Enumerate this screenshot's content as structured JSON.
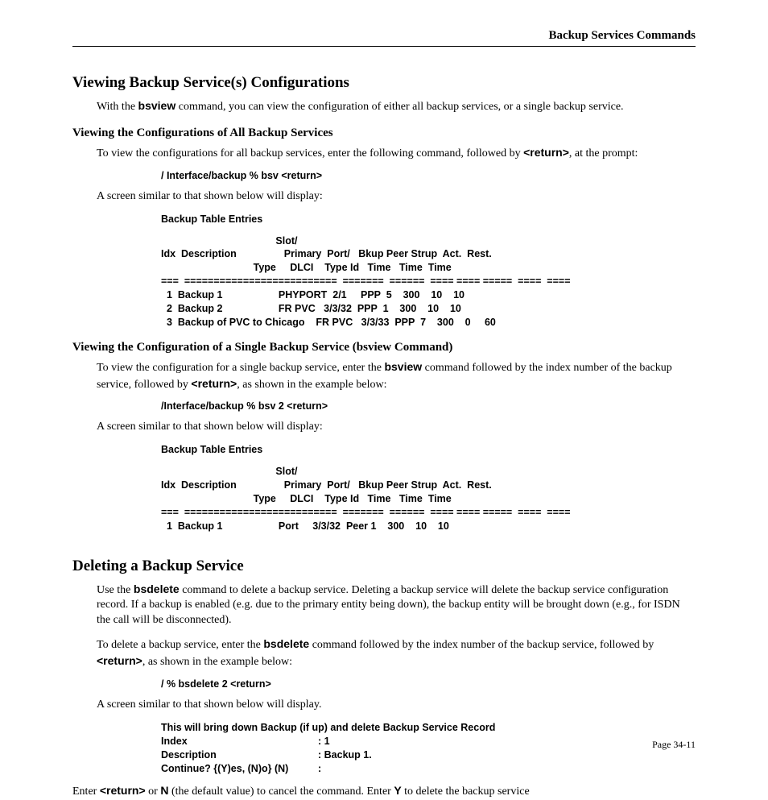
{
  "header": {
    "running": "Backup Services Commands"
  },
  "sec1": {
    "title": "Viewing Backup Service(s) Configurations",
    "intro_a": "With the ",
    "intro_cmd": "bsview",
    "intro_b": " command, you can view the configuration of either all backup services, or a single backup service.",
    "sub1": {
      "title": "Viewing the Configurations of All Backup Services",
      "p1_a": "To view the configurations for all backup services, enter the following command, followed by ",
      "p1_ret": "<return>",
      "p1_b": ", at the prompt:",
      "cmd": "/ Interface/backup % bsv <return>",
      "p2": "A screen similar to that shown below will display:",
      "table_title": "Backup Table Entries",
      "table_header": "                                         Slot/\nIdx  Description                 Primary  Port/   Bkup Peer Strup  Act.  Rest.\n                                 Type     DLCI    Type Id   Time   Time  Time\n===  ==========================  =======  ======  ==== ==== =====  ====  ====",
      "rows": "  1  Backup 1                    PHYPORT  2/1     PPP  5    300    10    10\n  2  Backup 2                    FR PVC   3/3/32  PPP  1    300    10    10\n  3  Backup of PVC to Chicago    FR PVC   3/3/33  PPP  7    300    0     60"
    },
    "sub2": {
      "title": "Viewing the Configuration of a Single Backup Service (bsview Command)",
      "p1_a": "To view the configuration for a single backup service, enter the ",
      "p1_cmd": "bsview",
      "p1_b": " command followed by the index number of the backup service, followed by ",
      "p1_ret": "<return>",
      "p1_c": ", as shown in the example below:",
      "cmd": "/Interface/backup % bsv 2 <return>",
      "p2": "A screen similar to that shown below will display:",
      "table_title": "Backup Table Entries",
      "table_header": "                                         Slot/\nIdx  Description                 Primary  Port/   Bkup Peer Strup  Act.  Rest.\n                                 Type     DLCI    Type Id   Time   Time  Time\n===  ==========================  =======  ======  ==== ==== =====  ====  ====",
      "rows": "  1  Backup 1                    Port     3/3/32  Peer 1    300    10    10"
    }
  },
  "sec2": {
    "title": "Deleting a Backup Service",
    "p1_a": "Use the ",
    "p1_cmd": "bsdelete",
    "p1_b": " command to delete a backup service. Deleting a backup service will delete the backup service configuration record. If a backup is enabled (e.g. due to the primary entity being down), the backup entity will be brought down (e.g., for ISDN the call will be disconnected).",
    "p2_a": "To delete a backup service, enter the ",
    "p2_cmd": "bsdelete",
    "p2_b": " command followed by the index number of the backup service, followed by ",
    "p2_ret": "<return>",
    "p2_c": ", as shown in the example below:",
    "cmd": "/ % bsdelete 2 <return>",
    "p3": "A screen similar to that shown below will display.",
    "out_line1": "This will bring down Backup (if up) and delete Backup Service Record",
    "kv": [
      {
        "k": "Index",
        "v": ": 1"
      },
      {
        "k": "Description",
        "v": ": Backup 1."
      },
      {
        "k": "Continue? {(Y)es, (N)o} (N)",
        "v": ":"
      }
    ],
    "p4_a": "Enter ",
    "p4_ret": "<return>",
    "p4_b": " or ",
    "p4_n": "N",
    "p4_c": " (the default value) to cancel the command. Enter ",
    "p4_y": "Y",
    "p4_d": " to delete the backup service"
  },
  "footer": {
    "page": "Page 34-11"
  }
}
